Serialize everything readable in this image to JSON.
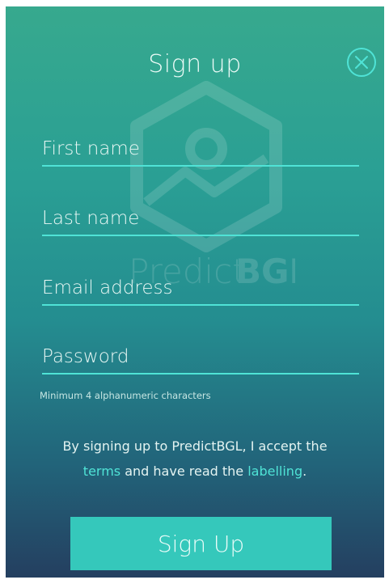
{
  "header": {
    "title": "Sign up",
    "close_icon": "close-circle-icon"
  },
  "watermark": {
    "brand_light": "Predict",
    "brand_bold": "BGL"
  },
  "form": {
    "first_name_placeholder": "First name",
    "first_name_value": "",
    "last_name_placeholder": "Last name",
    "last_name_value": "",
    "email_placeholder": "Email address",
    "email_value": "",
    "password_placeholder": "Password",
    "password_value": "",
    "password_hint": "Minimum 4 alphanumeric characters"
  },
  "terms": {
    "line1": "By signing up to PredictBGL, I accept the",
    "terms_link": "terms",
    "middle": " and have read the ",
    "labelling_link": "labelling",
    "end": "."
  },
  "actions": {
    "signup_label": "Sign Up"
  },
  "colors": {
    "accent": "#4fe3d6",
    "button": "#35c8bb",
    "gradient_top": "#37a98e",
    "gradient_bottom": "#243f60"
  }
}
